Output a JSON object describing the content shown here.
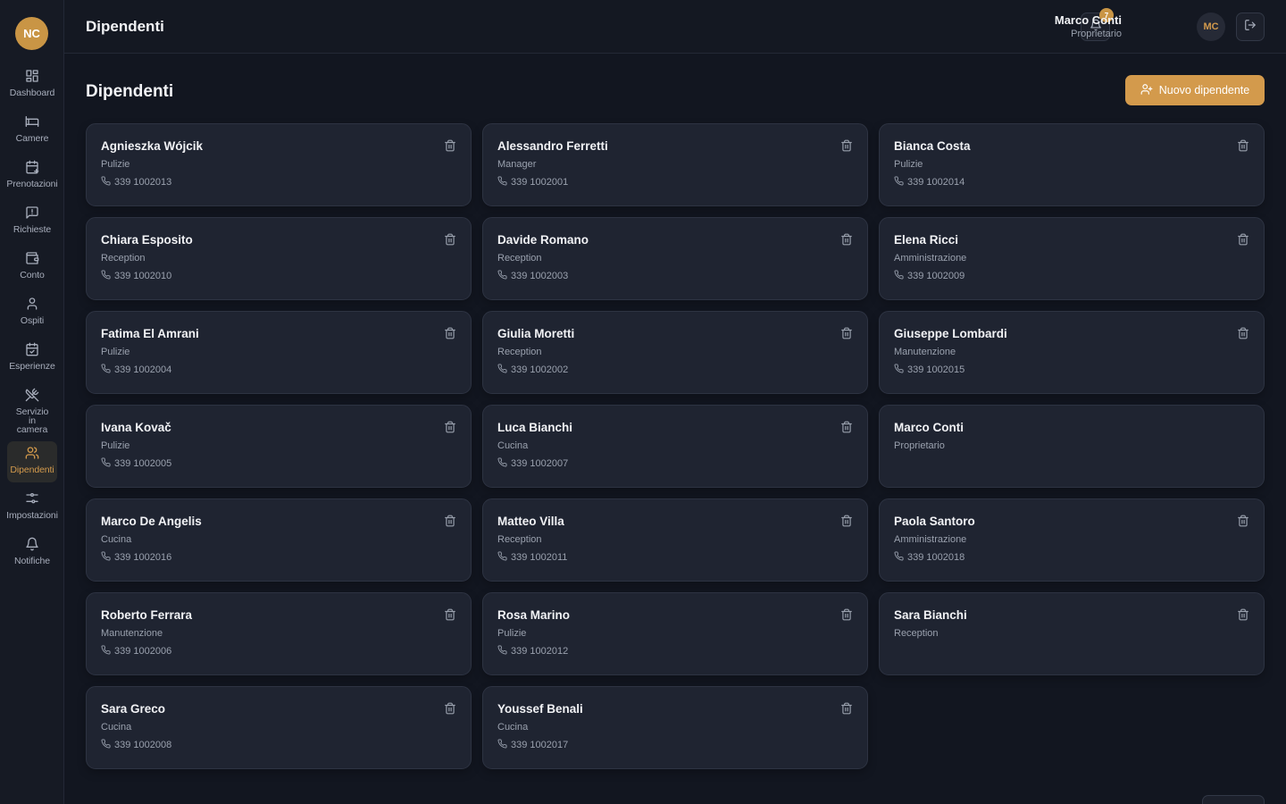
{
  "brand": {
    "initials": "NC"
  },
  "sidebar": {
    "items": [
      {
        "label": "Dashboard",
        "icon": "grid-icon"
      },
      {
        "label": "Camere",
        "icon": "bed-icon"
      },
      {
        "label": "Prenotazioni",
        "icon": "calendar-plus-icon"
      },
      {
        "label": "Richieste",
        "icon": "message-alert-icon"
      },
      {
        "label": "Conto",
        "icon": "wallet-icon"
      },
      {
        "label": "Ospiti",
        "icon": "user-icon"
      },
      {
        "label": "Esperienze",
        "icon": "calendar-check-icon"
      },
      {
        "label": "Servizio in camera",
        "icon": "utensils-crossed-icon"
      },
      {
        "label": "Dipendenti",
        "icon": "users-icon",
        "active": true
      },
      {
        "label": "Impostazioni",
        "icon": "sliders-icon"
      },
      {
        "label": "Notifiche",
        "icon": "bell-icon"
      }
    ]
  },
  "header": {
    "title": "Dipendenti",
    "notification_count": "7",
    "user_name": "Marco Conti",
    "user_role": "Proprietario",
    "user_initials": "MC"
  },
  "main": {
    "title": "Dipendenti",
    "new_button_label": "Nuovo dipendente"
  },
  "employees": [
    {
      "name": "Agnieszka Wójcik",
      "role": "Pulizie",
      "phone": "339 1002013",
      "deletable": true
    },
    {
      "name": "Alessandro Ferretti",
      "role": "Manager",
      "phone": "339 1002001",
      "deletable": true
    },
    {
      "name": "Bianca Costa",
      "role": "Pulizie",
      "phone": "339 1002014",
      "deletable": true
    },
    {
      "name": "Chiara Esposito",
      "role": "Reception",
      "phone": "339 1002010",
      "deletable": true
    },
    {
      "name": "Davide Romano",
      "role": "Reception",
      "phone": "339 1002003",
      "deletable": true
    },
    {
      "name": "Elena Ricci",
      "role": "Amministrazione",
      "phone": "339 1002009",
      "deletable": true
    },
    {
      "name": "Fatima El Amrani",
      "role": "Pulizie",
      "phone": "339 1002004",
      "deletable": true
    },
    {
      "name": "Giulia Moretti",
      "role": "Reception",
      "phone": "339 1002002",
      "deletable": true
    },
    {
      "name": "Giuseppe Lombardi",
      "role": "Manutenzione",
      "phone": "339 1002015",
      "deletable": true
    },
    {
      "name": "Ivana Kovač",
      "role": "Pulizie",
      "phone": "339 1002005",
      "deletable": true
    },
    {
      "name": "Luca Bianchi",
      "role": "Cucina",
      "phone": "339 1002007",
      "deletable": true
    },
    {
      "name": "Marco Conti",
      "role": "Proprietario",
      "phone": "",
      "deletable": false
    },
    {
      "name": "Marco De Angelis",
      "role": "Cucina",
      "phone": "339 1002016",
      "deletable": true
    },
    {
      "name": "Matteo Villa",
      "role": "Reception",
      "phone": "339 1002011",
      "deletable": true
    },
    {
      "name": "Paola Santoro",
      "role": "Amministrazione",
      "phone": "339 1002018",
      "deletable": true
    },
    {
      "name": "Roberto Ferrara",
      "role": "Manutenzione",
      "phone": "339 1002006",
      "deletable": true
    },
    {
      "name": "Rosa Marino",
      "role": "Pulizie",
      "phone": "339 1002012",
      "deletable": true
    },
    {
      "name": "Sara Bianchi",
      "role": "Reception",
      "phone": "",
      "deletable": true
    },
    {
      "name": "Sara Greco",
      "role": "Cucina",
      "phone": "339 1002008",
      "deletable": true
    },
    {
      "name": "Youssef Benali",
      "role": "Cucina",
      "phone": "339 1002017",
      "deletable": true
    }
  ],
  "colors": {
    "accent": "#d39a4c",
    "background": "#121620",
    "card": "#1f2431"
  }
}
